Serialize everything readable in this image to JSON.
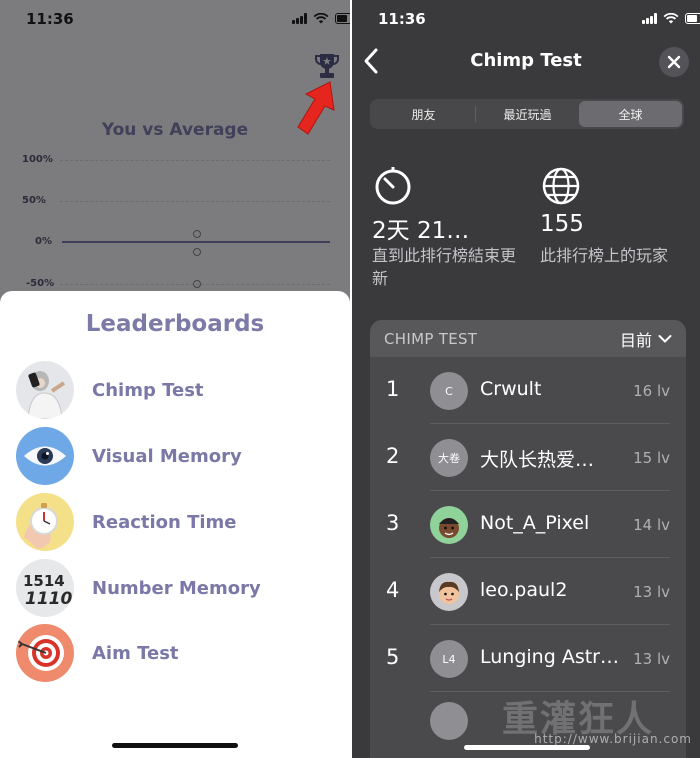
{
  "left": {
    "status": {
      "time": "11:36"
    },
    "chart": {
      "title": "You vs Average",
      "y_ticks": [
        "100%",
        "50%",
        "0%",
        "-50%"
      ]
    },
    "sheet": {
      "title": "Leaderboards",
      "items": [
        {
          "label": "Chimp Test",
          "icon": "chimp-icon"
        },
        {
          "label": "Visual Memory",
          "icon": "eye-icon"
        },
        {
          "label": "Reaction Time",
          "icon": "stopwatch-icon"
        },
        {
          "label": "Number Memory",
          "icon": "number-icon",
          "icon_text": "1514\n1110"
        },
        {
          "label": "Aim Test",
          "icon": "target-icon"
        }
      ]
    },
    "colors": {
      "accent": "#7a78a6",
      "arrow": "#e5261f"
    }
  },
  "right": {
    "status": {
      "time": "11:36"
    },
    "nav": {
      "title": "Chimp Test"
    },
    "segments": [
      {
        "label": "朋友",
        "active": false
      },
      {
        "label": "最近玩過",
        "active": false
      },
      {
        "label": "全球",
        "active": true
      }
    ],
    "stats": [
      {
        "icon": "timer-icon",
        "value": "2天 21…",
        "desc": "直到此排行榜結束更新"
      },
      {
        "icon": "globe-icon",
        "value": "155",
        "desc": "此排行榜上的玩家"
      }
    ],
    "board": {
      "title": "CHIMP TEST",
      "filter": "目前",
      "rows": [
        {
          "rank": "1",
          "avatar": "C",
          "name": "Crwult",
          "level": "16 lv"
        },
        {
          "rank": "2",
          "avatar": "大卷",
          "name": "大队长热爱…",
          "level": "15 lv"
        },
        {
          "rank": "3",
          "avatar": "",
          "name": "Not_A_Pixel",
          "level": "14 lv"
        },
        {
          "rank": "4",
          "avatar": "",
          "name": "leo.paul2",
          "level": "13 lv"
        },
        {
          "rank": "5",
          "avatar": "L4",
          "name": "Lunging Astr…",
          "level": "13 lv"
        }
      ]
    },
    "watermark": {
      "text": "重灌狂人",
      "url": "http://www.brijian.com"
    }
  }
}
